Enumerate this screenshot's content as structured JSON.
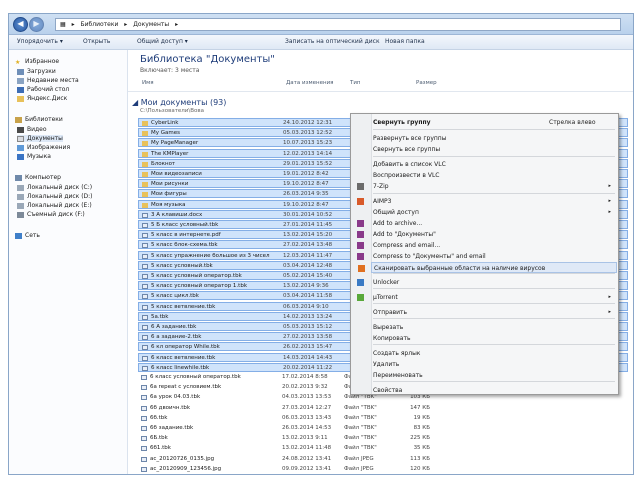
{
  "address": {
    "parts": [
      "Библиотеки",
      "Документы"
    ]
  },
  "toolbar": {
    "items": [
      "Упорядочить ▾",
      "Открыть",
      "Общий доступ ▾",
      "Записать на оптический диск",
      "Новая папка"
    ]
  },
  "sidebar": {
    "favorites_header": "Избранное",
    "favorites": [
      "Загрузки",
      "Недавние места",
      "Рабочий стол",
      "Яндекс.Диск"
    ],
    "libraries_header": "Библиотеки",
    "libraries": [
      "Видео",
      "Документы",
      "Изображения",
      "Музыка"
    ],
    "computer_header": "Компьютер",
    "computer": [
      "Локальный диск (C:)",
      "Локальный диск (D:)",
      "Локальный диск (E:)",
      "Съемный диск (F:)"
    ],
    "network": "Сеть"
  },
  "library": {
    "title": "Библиотека \"Документы\"",
    "subtitle": "Включает: 3 места",
    "columns": {
      "name": "Имя",
      "date": "Дата изменения",
      "type": "Тип",
      "size": "Размер"
    },
    "group_title": "Мои документы (93)",
    "group_path": "C:\\Пользователи\\Вова"
  },
  "files": [
    {
      "name": "CyberLink",
      "date": "24.10.2012 12:31",
      "type": "",
      "size": ""
    },
    {
      "name": "My Games",
      "date": "05.03.2013 12:52",
      "type": "",
      "size": ""
    },
    {
      "name": "My PageManager",
      "date": "10.07.2013 15:23",
      "type": "",
      "size": ""
    },
    {
      "name": "The KMPlayer",
      "date": "12.02.2013 14:14",
      "type": "",
      "size": ""
    },
    {
      "name": "Блокнот",
      "date": "29.01.2013 15:52",
      "type": "",
      "size": ""
    },
    {
      "name": "Мои видеозаписи",
      "date": "19.01.2012 8:42",
      "type": "",
      "size": ""
    },
    {
      "name": "Мои рисунки",
      "date": "19.10.2012 8:47",
      "type": "",
      "size": ""
    },
    {
      "name": "Мои фигуры",
      "date": "26.03.2014 9:35",
      "type": "",
      "size": ""
    },
    {
      "name": "Моя музыка",
      "date": "19.10.2012 8:47",
      "type": "",
      "size": ""
    },
    {
      "name": "3 А клавиши.docx",
      "date": "30.01.2014 10:52",
      "type": "",
      "size": ""
    },
    {
      "name": "5 Б класс условный.tbk",
      "date": "27.01.2014 11:45",
      "type": "",
      "size": ""
    },
    {
      "name": "5 класс в интернете.pdf",
      "date": "13.02.2014 15:20",
      "type": "",
      "size": ""
    },
    {
      "name": "5 класс блок-схема.tbk",
      "date": "27.02.2014 13:48",
      "type": "",
      "size": ""
    },
    {
      "name": "5 класс упражнение большое из 3 чисел",
      "date": "12.03.2014 11:47",
      "type": "",
      "size": ""
    },
    {
      "name": "5 класс условный.tbk",
      "date": "03.04.2014 12:48",
      "type": "",
      "size": ""
    },
    {
      "name": "5 класс условный оператор.tbk",
      "date": "05.02.2014 15:40",
      "type": "",
      "size": ""
    },
    {
      "name": "5 класс условный оператор 1.tbk",
      "date": "13.02.2014 9:36",
      "type": "",
      "size": ""
    },
    {
      "name": "5 класс цикл.tbk",
      "date": "03.04.2014 11:58",
      "type": "",
      "size": ""
    },
    {
      "name": "5 класс ветвление.tbk",
      "date": "06.03.2014 9:10",
      "type": "",
      "size": ""
    },
    {
      "name": "5а.tbk",
      "date": "14.02.2013 13:24",
      "type": "",
      "size": ""
    },
    {
      "name": "6 А задание.tbk",
      "date": "05.03.2013 15:12",
      "type": "",
      "size": ""
    },
    {
      "name": "6 а задание-2.tbk",
      "date": "27.02.2013 13:58",
      "type": "",
      "size": ""
    },
    {
      "name": "6 кл оператор While.tbk",
      "date": "26.02.2013 15:47",
      "type": "",
      "size": ""
    },
    {
      "name": "6 класс ветвление.tbk",
      "date": "14.03.2014 14:43",
      "type": "",
      "size": ""
    },
    {
      "name": "6 класс linewhile.tbk",
      "date": "20.02.2014 11:22",
      "type": "",
      "size": ""
    },
    {
      "name": "6 класс условный оператор.tbk",
      "date": "17.02.2014 8:58",
      "type": "Файл \"TBK\"",
      "size": ""
    },
    {
      "name": "6а repeat с условием.tbk",
      "date": "20.02.2013 9:32",
      "type": "Файл \"TBK\"",
      "size": "24 КБ"
    },
    {
      "name": "6а урок 04.03.tbk",
      "date": "04.03.2013 13:53",
      "type": "Файл \"TBK\"",
      "size": "103 КБ"
    },
    {
      "name": "6б двоичн.tbk",
      "date": "27.03.2014 12:27",
      "type": "Файл \"TBK\"",
      "size": "147 КБ"
    },
    {
      "name": "6б.tbk",
      "date": "06.03.2013 13:43",
      "type": "Файл \"TBK\"",
      "size": "19 КБ"
    },
    {
      "name": "6б задание.tbk",
      "date": "26.03.2014 14:53",
      "type": "Файл \"TBK\"",
      "size": "83 КБ"
    },
    {
      "name": "6Б.tbk",
      "date": "13.02.2013 9:11",
      "type": "Файл \"TBK\"",
      "size": "225 КБ"
    },
    {
      "name": "6б1.tbk",
      "date": "13.02.2014 11:48",
      "type": "Файл \"TBK\"",
      "size": "35 КБ"
    },
    {
      "name": "ac_20120726_0135.jpg",
      "date": "24.08.2012 13:41",
      "type": "Файл JPEG",
      "size": "113 КБ"
    },
    {
      "name": "ac_20120909_123456.jpg",
      "date": "09.09.2012 13:41",
      "type": "Файл JPEG",
      "size": "120 КБ"
    }
  ],
  "context_menu": {
    "items": [
      {
        "label": "Свернуть группу",
        "shortcut": "Стрелка влево",
        "arrow": false,
        "bold": true
      },
      {
        "label": "Развернуть все группы",
        "shortcut": "",
        "arrow": false
      },
      {
        "label": "Свернуть все группы",
        "shortcut": "",
        "arrow": false
      },
      {
        "label": "Добавить в список VLC",
        "shortcut": "",
        "arrow": false
      },
      {
        "label": "Воспроизвести в VLC",
        "shortcut": "",
        "arrow": false
      },
      {
        "label": "7-Zip",
        "shortcut": "",
        "arrow": true
      },
      {
        "label": "AIMP3",
        "shortcut": "",
        "arrow": true
      },
      {
        "label": "Общий доступ",
        "shortcut": "",
        "arrow": true
      },
      {
        "label": "Add to archive...",
        "shortcut": "",
        "arrow": false
      },
      {
        "label": "Add to \"Документы\"",
        "shortcut": "",
        "arrow": false
      },
      {
        "label": "Compress and email...",
        "shortcut": "",
        "arrow": false
      },
      {
        "label": "Compress to \"Документы\" and email",
        "shortcut": "",
        "arrow": false
      },
      {
        "label": "Сканировать выбранные области на наличие вирусов",
        "shortcut": "",
        "arrow": false
      },
      {
        "label": "Unlocker",
        "shortcut": "",
        "arrow": false
      },
      {
        "label": "µTorrent",
        "shortcut": "",
        "arrow": true
      },
      {
        "label": "Отправить",
        "shortcut": "",
        "arrow": true
      },
      {
        "label": "Вырезать",
        "shortcut": "",
        "arrow": false
      },
      {
        "label": "Копировать",
        "shortcut": "",
        "arrow": false
      },
      {
        "label": "Создать ярлык",
        "shortcut": "",
        "arrow": false
      },
      {
        "label": "Удалить",
        "shortcut": "",
        "arrow": false
      },
      {
        "label": "Переименовать",
        "shortcut": "",
        "arrow": false
      },
      {
        "label": "Свойства",
        "shortcut": "",
        "arrow": false
      }
    ],
    "arrow_glyph": "▸"
  },
  "colors": {
    "selection": "#cfe3fb",
    "accent": "#1f3d7a",
    "folder": "#e8c15a"
  }
}
